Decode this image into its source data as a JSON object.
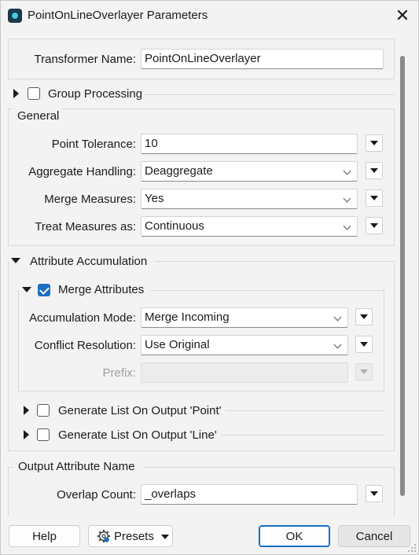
{
  "window": {
    "title": "PointOnLineOverlayer Parameters",
    "close_glyph": "✕"
  },
  "transformer": {
    "name_label": "Transformer Name:",
    "name_value": "PointOnLineOverlayer"
  },
  "group_processing": {
    "label": "Group Processing",
    "checked": false,
    "expanded": false
  },
  "general": {
    "heading": "General",
    "point_tolerance_label": "Point Tolerance:",
    "point_tolerance_value": "10",
    "aggregate_handling_label": "Aggregate Handling:",
    "aggregate_handling_value": "Deaggregate",
    "merge_measures_label": "Merge Measures:",
    "merge_measures_value": "Yes",
    "treat_measures_label": "Treat Measures as:",
    "treat_measures_value": "Continuous"
  },
  "attribute_accumulation": {
    "heading": "Attribute Accumulation",
    "expanded": true,
    "merge_attributes": {
      "label": "Merge Attributes",
      "checked": true,
      "expanded": true,
      "accumulation_mode_label": "Accumulation Mode:",
      "accumulation_mode_value": "Merge Incoming",
      "conflict_resolution_label": "Conflict Resolution:",
      "conflict_resolution_value": "Use Original",
      "prefix_label": "Prefix:",
      "prefix_value": ""
    },
    "list_point": {
      "label": "Generate List On Output 'Point'",
      "checked": false
    },
    "list_line": {
      "label": "Generate List On Output 'Line'",
      "checked": false
    }
  },
  "output": {
    "heading": "Output Attribute Name",
    "overlap_count_label": "Overlap Count:",
    "overlap_count_value": "_overlaps"
  },
  "footer": {
    "help": "Help",
    "presets": "Presets",
    "ok": "OK",
    "cancel": "Cancel"
  },
  "colors": {
    "accent": "#1a6fc4",
    "background": "#f3f3f3"
  }
}
